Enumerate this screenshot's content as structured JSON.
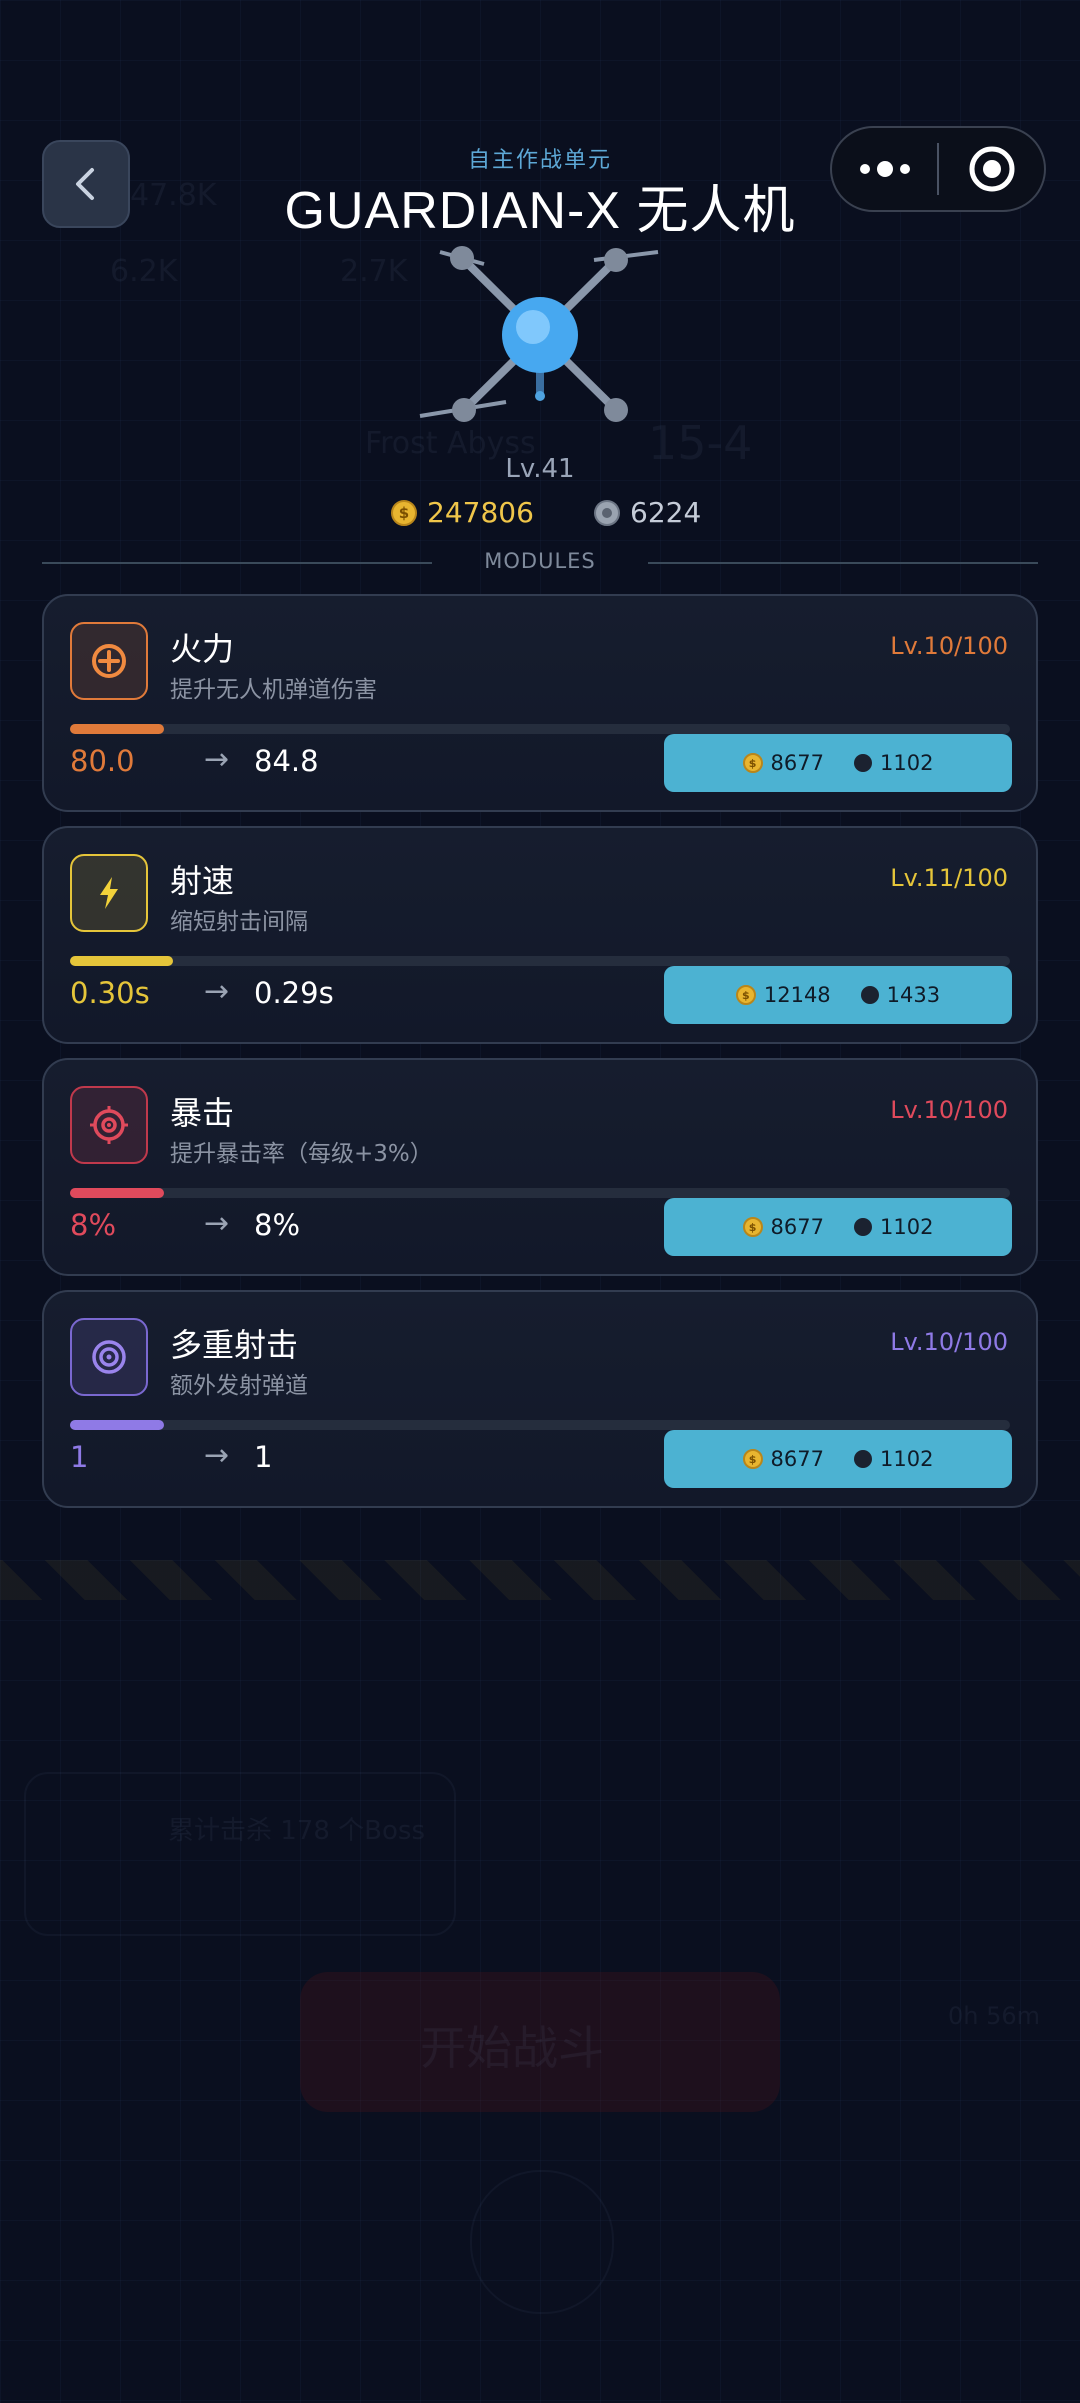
{
  "header": {
    "subtitle": "自主作战单元",
    "title": "GUARDIAN-X 无人机",
    "level": "Lv.41",
    "coins": "247806",
    "gems": "6224",
    "section_label": "MODULES"
  },
  "modules": [
    {
      "name": "火力",
      "desc": "提升无人机弹道伤害",
      "level": "Lv.10/100",
      "current": "80.0",
      "next": "84.8",
      "cost_coin": "8677",
      "cost_gem": "1102",
      "progress": 0.1,
      "color": "#e07a3a",
      "icon": "crosshair-plus-icon"
    },
    {
      "name": "射速",
      "desc": "缩短射击间隔",
      "level": "Lv.11/100",
      "current": "0.30s",
      "next": "0.29s",
      "cost_coin": "12148",
      "cost_gem": "1433",
      "progress": 0.11,
      "color": "#e5c53a",
      "icon": "lightning-icon"
    },
    {
      "name": "暴击",
      "desc": "提升暴击率（每级+3%）",
      "level": "Lv.10/100",
      "current": "8%",
      "next": "8%",
      "cost_coin": "8677",
      "cost_gem": "1102",
      "progress": 0.1,
      "color": "#e04a5c",
      "icon": "target-icon"
    },
    {
      "name": "多重射击",
      "desc": "额外发射弹道",
      "level": "Lv.10/100",
      "current": "1",
      "next": "1",
      "cost_coin": "8677",
      "cost_gem": "1102",
      "progress": 0.1,
      "color": "#8f7ae6",
      "icon": "rings-icon"
    }
  ],
  "arrow_glyph": "→",
  "background_ghost": {
    "gold": "47.8K",
    "attack": "6.2K",
    "defense": "2.7K",
    "stage_name": "Frost Abyss",
    "stage": "15-4",
    "quest": "累计击杀 178 个Boss",
    "start_button": "开始战斗",
    "timer": "0h 56m"
  }
}
